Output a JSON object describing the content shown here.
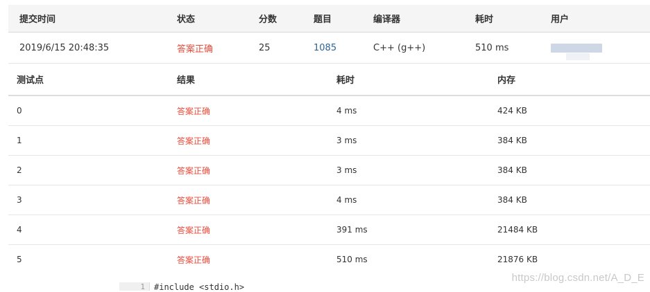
{
  "summary": {
    "headers": {
      "submit_time": "提交时间",
      "status": "状态",
      "score": "分数",
      "problem": "题目",
      "compiler": "编译器",
      "time": "耗时",
      "user": "用户"
    },
    "row": {
      "submit_time": "2019/6/15 20:48:35",
      "status": "答案正确",
      "score": "25",
      "problem": "1085",
      "compiler": "C++ (g++)",
      "time": "510 ms"
    }
  },
  "cases": {
    "headers": {
      "case": "测试点",
      "result": "结果",
      "time": "耗时",
      "memory": "内存"
    },
    "rows": [
      {
        "case": "0",
        "result": "答案正确",
        "time": "4 ms",
        "memory": "424 KB"
      },
      {
        "case": "1",
        "result": "答案正确",
        "time": "3 ms",
        "memory": "384 KB"
      },
      {
        "case": "2",
        "result": "答案正确",
        "time": "3 ms",
        "memory": "384 KB"
      },
      {
        "case": "3",
        "result": "答案正确",
        "time": "4 ms",
        "memory": "384 KB"
      },
      {
        "case": "4",
        "result": "答案正确",
        "time": "391 ms",
        "memory": "21484 KB"
      },
      {
        "case": "5",
        "result": "答案正确",
        "time": "510 ms",
        "memory": "21876 KB"
      }
    ]
  },
  "code": {
    "line_number": "1",
    "first_line": "#include <stdio.h>"
  },
  "watermark": "https://blog.csdn.net/A_D_E",
  "colors": {
    "accepted": "#e74c3c",
    "link": "#2a6496",
    "header_bg": "#f5f5f5"
  }
}
